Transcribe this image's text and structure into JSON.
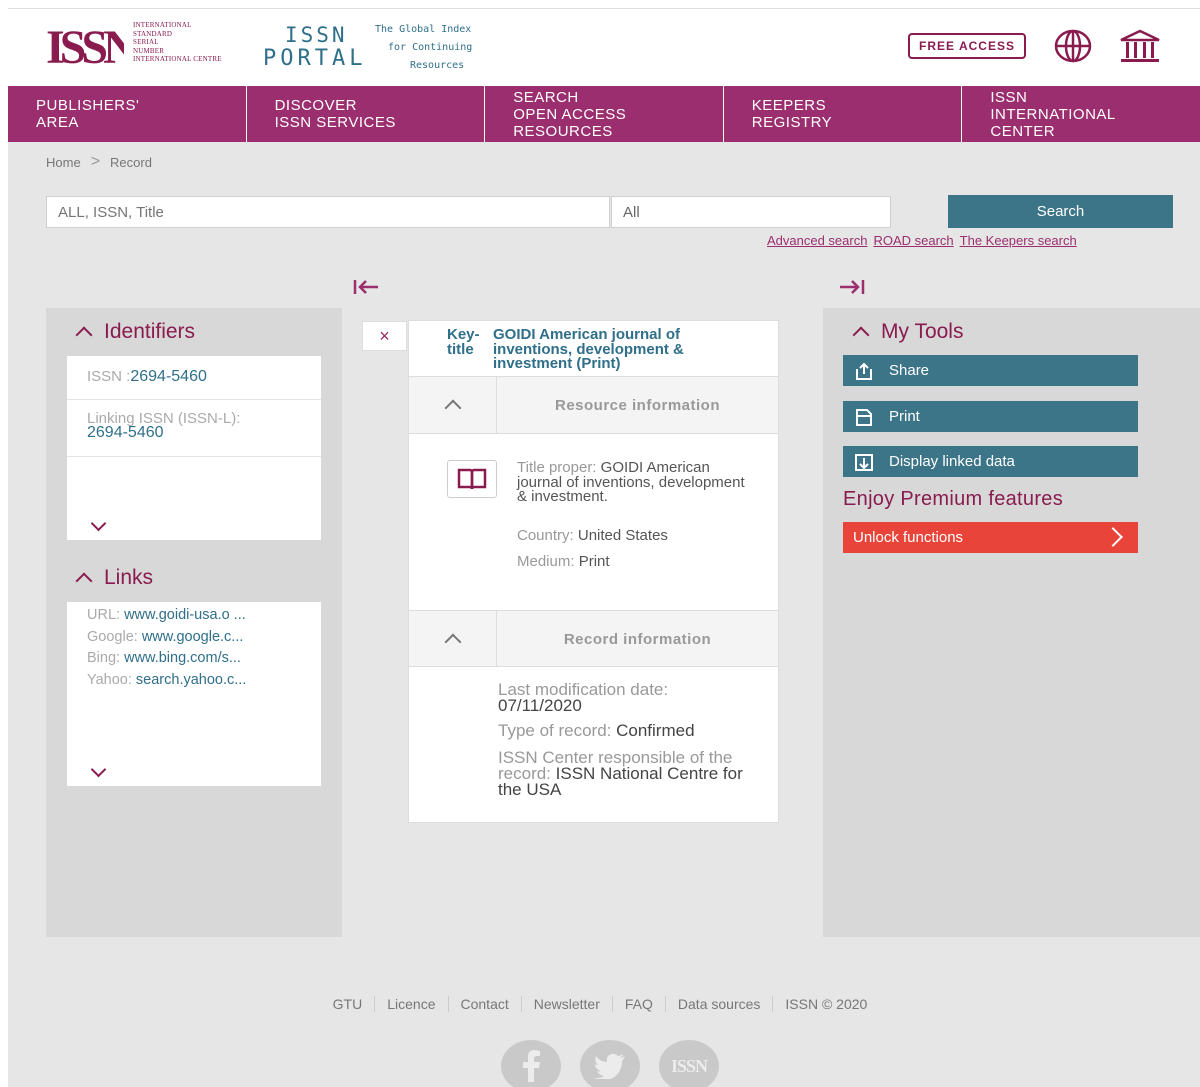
{
  "header": {
    "issn_logo_text": "ISSN",
    "issn_small_lines": [
      "INTERNATIONAL",
      "STANDARD",
      "SERIAL",
      "NUMBER",
      "INTERNATIONAL CENTRE"
    ],
    "portal_line1": "ISSN",
    "portal_line2": "PORTAL",
    "portal_tagline": [
      "The Global Index",
      "for Continuing",
      "Resources"
    ],
    "free_access": "FREE ACCESS",
    "icons": [
      "globe-icon",
      "institution-icon"
    ]
  },
  "nav": [
    "PUBLISHERS'\nAREA",
    "DISCOVER\nISSN SERVICES",
    "SEARCH\nOPEN ACCESS\nRESOURCES",
    "KEEPERS\nREGISTRY",
    "ISSN\nINTERNATIONAL\nCENTER"
  ],
  "breadcrumb": {
    "home": "Home",
    "current": "Record"
  },
  "search": {
    "placeholder": "ALL, ISSN, Title",
    "scope": "All",
    "button": "Search",
    "links": [
      "Advanced search",
      "ROAD search",
      "The Keepers search"
    ]
  },
  "identifiers": {
    "title": "Identifiers",
    "issn_label": "ISSN :",
    "issn_value": "2694-5460",
    "linking_label": "Linking ISSN (ISSN-L):",
    "linking_value": "2694-5460"
  },
  "links": {
    "title": "Links",
    "items": [
      {
        "label": "URL: ",
        "value": "www.goidi-usa.o ..."
      },
      {
        "label": "Google: ",
        "value": "www.google.c..."
      },
      {
        "label": "Bing: ",
        "value": "www.bing.com/s..."
      },
      {
        "label": "Yahoo: ",
        "value": "search.yahoo.c..."
      }
    ]
  },
  "record": {
    "close": "×",
    "key_title_label": "Key-\ntitle",
    "key_title_value": "GOIDI American journal of inventions, development & investment (Print)",
    "resource_section": "Resource information",
    "title_proper_label": "Title proper: ",
    "title_proper_value": "GOIDI American journal of inventions, development & investment.",
    "country_label": "Country: ",
    "country_value": "United States",
    "medium_label": "Medium: ",
    "medium_value": "Print",
    "record_section": "Record information",
    "last_mod_label": "Last modification date:",
    "last_mod_value": "07/11/2020",
    "type_label": "Type of record: ",
    "type_value": "Confirmed",
    "center_label": "ISSN Center responsible of the record: ",
    "center_value": "ISSN National Centre for the USA"
  },
  "tools": {
    "title": "My Tools",
    "share": "Share",
    "print": "Print",
    "linked": "Display linked data",
    "premium": "Enjoy Premium features",
    "unlock": "Unlock functions"
  },
  "footer": {
    "links": [
      "GTU",
      "Licence",
      "Contact",
      "Newsletter",
      "FAQ",
      "Data sources",
      "ISSN © 2020"
    ],
    "social": [
      "facebook-icon",
      "twitter-icon",
      "issn-icon"
    ],
    "issn_social_text": "ISSN"
  },
  "colors": {
    "brand": "#9b2e6e",
    "accent": "#3c7588",
    "unlock": "#e8443a"
  }
}
